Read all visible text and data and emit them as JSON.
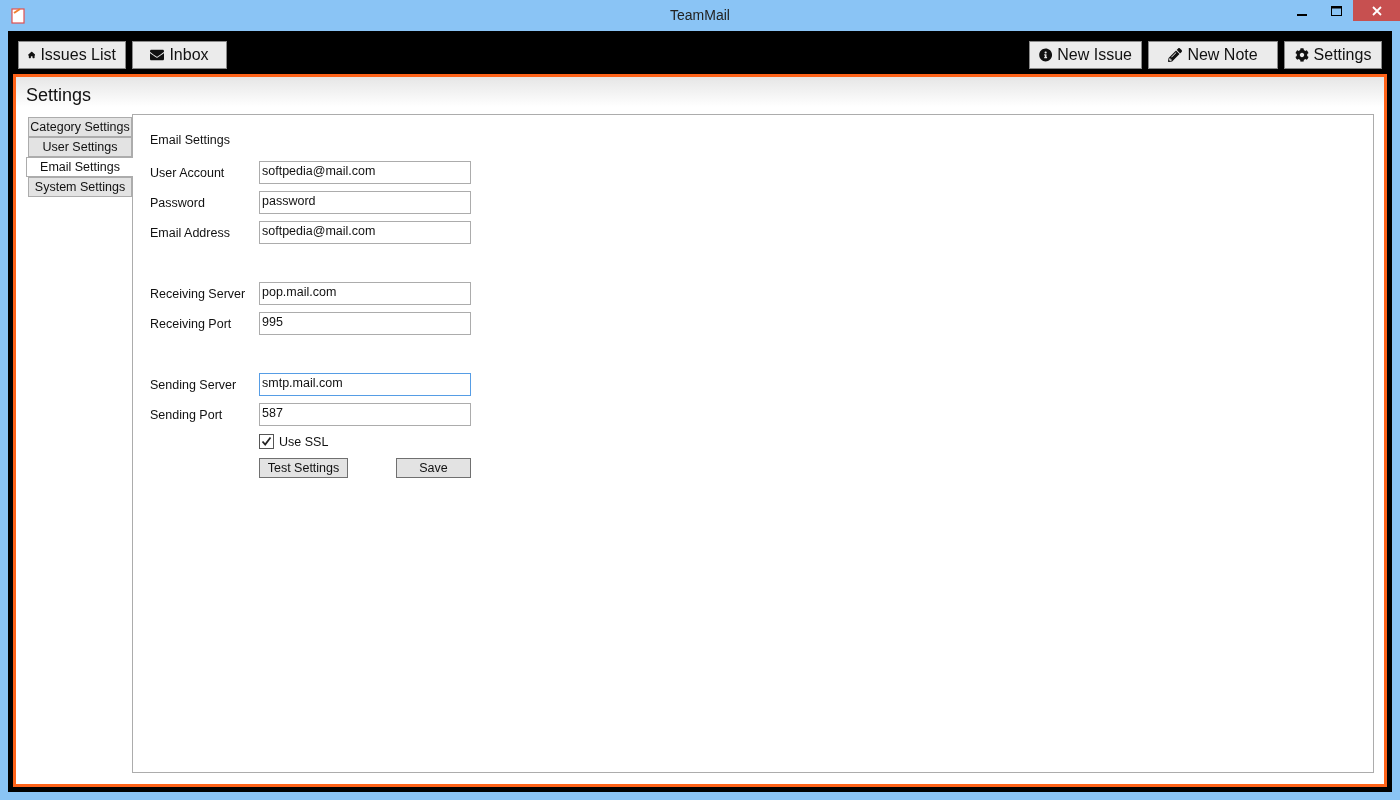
{
  "window": {
    "title": "TeamMail"
  },
  "toolbar": {
    "left": [
      {
        "label": "Issues List"
      },
      {
        "label": "Inbox"
      }
    ],
    "right": [
      {
        "label": "New Issue"
      },
      {
        "label": "New Note"
      },
      {
        "label": "Settings"
      }
    ]
  },
  "page": {
    "title": "Settings"
  },
  "tabs": [
    {
      "label": "Category Settings",
      "selected": false
    },
    {
      "label": "User Settings",
      "selected": false
    },
    {
      "label": "Email Settings",
      "selected": true
    },
    {
      "label": "System Settings",
      "selected": false
    }
  ],
  "email_settings": {
    "heading": "Email Settings",
    "groups": [
      [
        {
          "label": "User Account",
          "value": "softpedia@mail.com",
          "focused": false
        },
        {
          "label": "Password",
          "value": "password",
          "focused": false
        },
        {
          "label": "Email Address",
          "value": "softpedia@mail.com",
          "focused": false
        }
      ],
      [
        {
          "label": "Receiving Server",
          "value": "pop.mail.com",
          "focused": false
        },
        {
          "label": "Receiving Port",
          "value": "995",
          "focused": false
        }
      ],
      [
        {
          "label": "Sending Server",
          "value": "smtp.mail.com",
          "focused": true
        },
        {
          "label": "Sending Port",
          "value": "587",
          "focused": false
        }
      ]
    ],
    "use_ssl": {
      "label": "Use SSL",
      "checked": true
    },
    "buttons": [
      {
        "label": "Test Settings"
      },
      {
        "label": "Save"
      }
    ]
  }
}
